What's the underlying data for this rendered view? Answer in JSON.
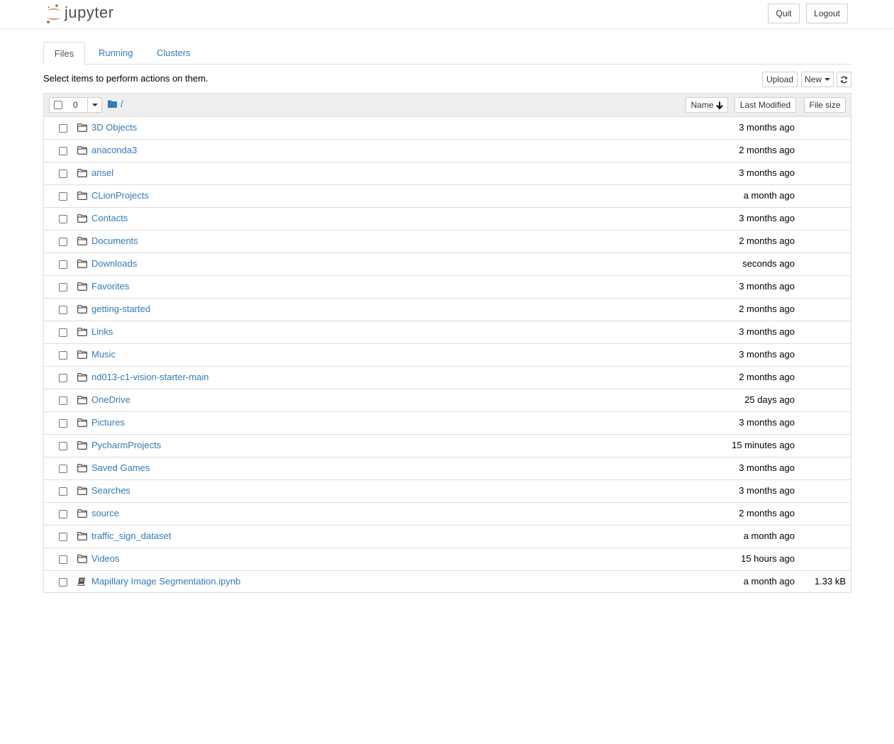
{
  "header": {
    "logo_text": "jupyter",
    "quit_label": "Quit",
    "logout_label": "Logout"
  },
  "tabs": [
    {
      "label": "Files",
      "active": true
    },
    {
      "label": "Running",
      "active": false
    },
    {
      "label": "Clusters",
      "active": false
    }
  ],
  "toolbar": {
    "hint": "Select items to perform actions on them.",
    "upload_label": "Upload",
    "new_label": "New",
    "refresh_icon": "refresh-icon"
  },
  "list_header": {
    "selected_count": "0",
    "breadcrumb_sep": "/",
    "col_name": "Name",
    "col_modified": "Last Modified",
    "col_size": "File size"
  },
  "items": [
    {
      "name": "3D Objects",
      "modified": "3 months ago",
      "size": "",
      "type": "folder"
    },
    {
      "name": "anaconda3",
      "modified": "2 months ago",
      "size": "",
      "type": "folder"
    },
    {
      "name": "ansel",
      "modified": "3 months ago",
      "size": "",
      "type": "folder"
    },
    {
      "name": "CLionProjects",
      "modified": "a month ago",
      "size": "",
      "type": "folder"
    },
    {
      "name": "Contacts",
      "modified": "3 months ago",
      "size": "",
      "type": "folder"
    },
    {
      "name": "Documents",
      "modified": "2 months ago",
      "size": "",
      "type": "folder"
    },
    {
      "name": "Downloads",
      "modified": "seconds ago",
      "size": "",
      "type": "folder"
    },
    {
      "name": "Favorites",
      "modified": "3 months ago",
      "size": "",
      "type": "folder"
    },
    {
      "name": "getting-started",
      "modified": "2 months ago",
      "size": "",
      "type": "folder"
    },
    {
      "name": "Links",
      "modified": "3 months ago",
      "size": "",
      "type": "folder"
    },
    {
      "name": "Music",
      "modified": "3 months ago",
      "size": "",
      "type": "folder"
    },
    {
      "name": "nd013-c1-vision-starter-main",
      "modified": "2 months ago",
      "size": "",
      "type": "folder"
    },
    {
      "name": "OneDrive",
      "modified": "25 days ago",
      "size": "",
      "type": "folder"
    },
    {
      "name": "Pictures",
      "modified": "3 months ago",
      "size": "",
      "type": "folder"
    },
    {
      "name": "PycharmProjects",
      "modified": "15 minutes ago",
      "size": "",
      "type": "folder"
    },
    {
      "name": "Saved Games",
      "modified": "3 months ago",
      "size": "",
      "type": "folder"
    },
    {
      "name": "Searches",
      "modified": "3 months ago",
      "size": "",
      "type": "folder"
    },
    {
      "name": "source",
      "modified": "2 months ago",
      "size": "",
      "type": "folder"
    },
    {
      "name": "traffic_sign_dataset",
      "modified": "a month ago",
      "size": "",
      "type": "folder"
    },
    {
      "name": "Videos",
      "modified": "15 hours ago",
      "size": "",
      "type": "folder"
    },
    {
      "name": "Mapillary Image Segmentation.ipynb",
      "modified": "a month ago",
      "size": "1.33 kB",
      "type": "notebook"
    }
  ],
  "colors": {
    "link": "#337ab7",
    "logo_orange": "#f37726",
    "logo_gray": "#767677",
    "border": "#dddddd"
  }
}
